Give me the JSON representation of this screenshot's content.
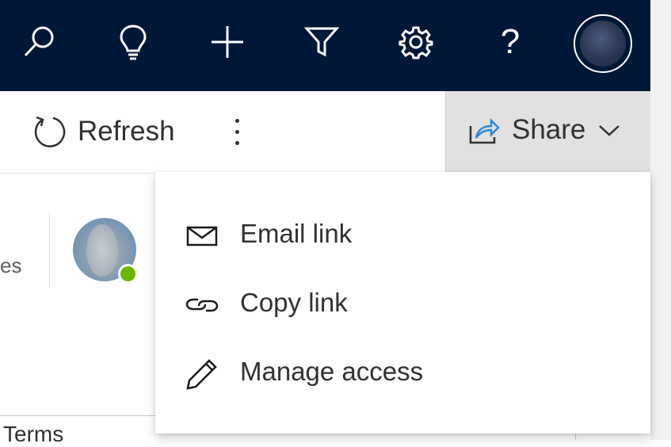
{
  "topbar": {
    "icons": [
      "search-icon",
      "lightbulb-icon",
      "add-icon",
      "filter-icon",
      "settings-icon",
      "help-icon"
    ],
    "help_glyph": "?",
    "background_color": "#001738"
  },
  "command_bar": {
    "refresh_label": "Refresh",
    "more_icon": "more-vertical-icon",
    "share_label": "Share"
  },
  "content": {
    "truncated_text": "es",
    "presence_status_color": "#6bb700",
    "footer_text": "Terms"
  },
  "share_menu": {
    "items": [
      {
        "label": "Email link",
        "icon": "mail-icon"
      },
      {
        "label": "Copy link",
        "icon": "link-icon"
      },
      {
        "label": "Manage access",
        "icon": "pencil-icon"
      }
    ]
  },
  "colors": {
    "share_icon_accent": "#2b88d8",
    "text": "#323130"
  }
}
